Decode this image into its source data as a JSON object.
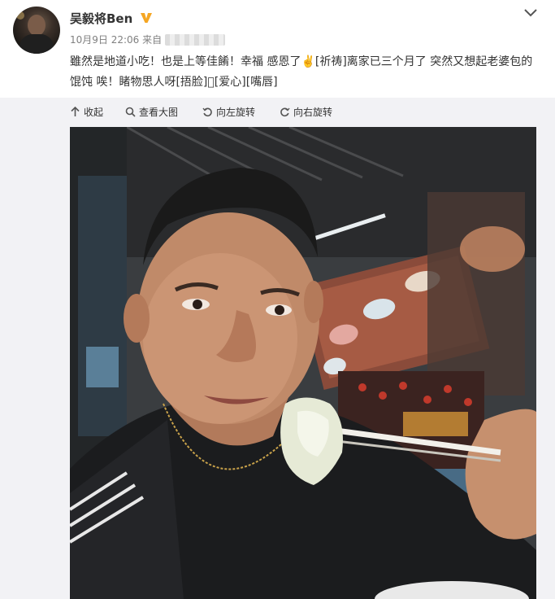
{
  "post": {
    "author": "吴毅将Ben",
    "verified_badge": "V",
    "meta": "10月9日 22:06 来自",
    "text": "雖然是地道小吃！也是上等佳餚！幸福 感恩了✌️[祈祷]离家已三个月了 突然又想起老婆包的馄饨 唉！睹物思人呀[捂脸]⃣[爱心][嘴唇]"
  },
  "toolbar": {
    "collapse": "收起",
    "view_large": "查看大图",
    "rotate_left": "向左旋转",
    "rotate_right": "向右旋转"
  },
  "icons": {
    "collapse": "arrow-up-icon",
    "zoom": "search-icon",
    "rotate_left": "rotate-left-icon",
    "rotate_right": "rotate-right-icon",
    "dropdown": "chevron-down-icon"
  },
  "colors": {
    "toolbar_bg": "#f2f2f5",
    "verified_gold": "#f5a623",
    "text": "#333333",
    "meta": "#808080"
  }
}
